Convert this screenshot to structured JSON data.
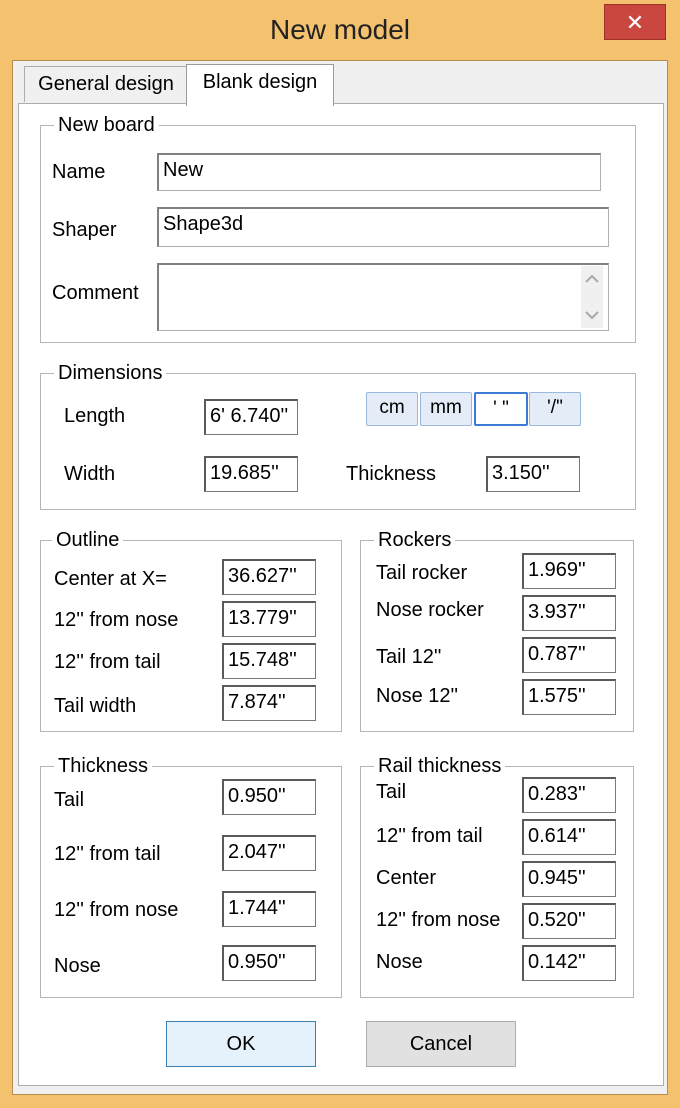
{
  "window": {
    "title": "New model",
    "close_glyph": "✕"
  },
  "tabs": [
    {
      "label": "General design"
    },
    {
      "label": "Blank design"
    }
  ],
  "new_board": {
    "group_label": "New board",
    "name_label": "Name",
    "name_value": "New",
    "shaper_label": "Shaper",
    "shaper_value": "Shape3d",
    "comment_label": "Comment",
    "comment_value": ""
  },
  "dimensions": {
    "group_label": "Dimensions",
    "length_label": "Length",
    "length_value": "6' 6.740''",
    "width_label": "Width",
    "width_value": "19.685''",
    "thickness_label": "Thickness",
    "thickness_value": "3.150''",
    "units": [
      {
        "label": "cm"
      },
      {
        "label": "mm"
      },
      {
        "label": "' \""
      },
      {
        "label": "'/\""
      }
    ],
    "active_unit": "' \""
  },
  "outline": {
    "group_label": "Outline",
    "rows": [
      {
        "label": "Center at X=",
        "value": "36.627''"
      },
      {
        "label": "12'' from nose",
        "value": "13.779''"
      },
      {
        "label": "12'' from tail",
        "value": "15.748''"
      },
      {
        "label": "Tail width",
        "value": "7.874''"
      }
    ]
  },
  "rockers": {
    "group_label": "Rockers",
    "rows": [
      {
        "label": "Tail rocker",
        "value": "1.969''"
      },
      {
        "label": "Nose rocker",
        "value": "3.937''"
      },
      {
        "label": "Tail 12''",
        "value": "0.787''"
      },
      {
        "label": "Nose 12''",
        "value": "1.575''"
      }
    ]
  },
  "thickness": {
    "group_label": "Thickness",
    "rows": [
      {
        "label": "Tail",
        "value": "0.950''"
      },
      {
        "label": "12'' from tail",
        "value": "2.047''"
      },
      {
        "label": "12'' from nose",
        "value": "1.744''"
      },
      {
        "label": "Nose",
        "value": "0.950''"
      }
    ]
  },
  "rail_thickness": {
    "group_label": "Rail thickness",
    "rows": [
      {
        "label": "Tail",
        "value": "0.283''"
      },
      {
        "label": "12'' from tail",
        "value": "0.614''"
      },
      {
        "label": "Center",
        "value": "0.945''"
      },
      {
        "label": "12'' from nose",
        "value": "0.520''"
      },
      {
        "label": "Nose",
        "value": "0.142''"
      }
    ]
  },
  "buttons": {
    "ok": "OK",
    "cancel": "Cancel"
  }
}
